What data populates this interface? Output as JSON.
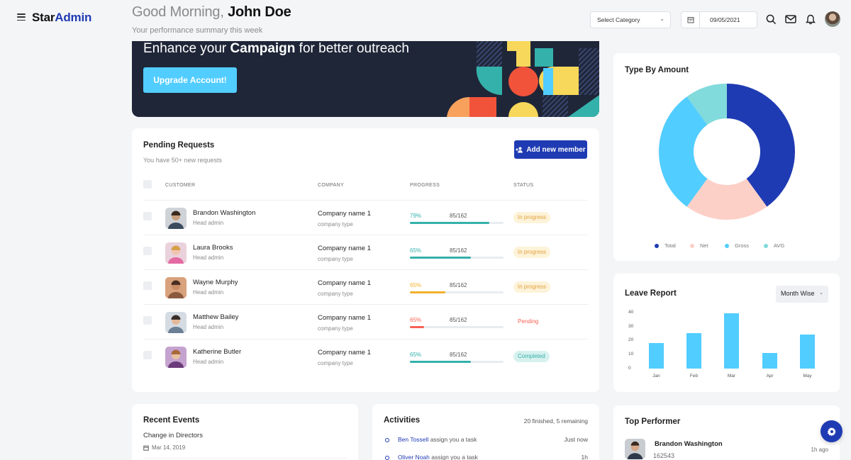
{
  "brand": {
    "part1": "Star",
    "part2": "Admin"
  },
  "header": {
    "greeting": "Good Morning, ",
    "user_name": "John Doe",
    "subtitle": "Your performance summary this week",
    "category_select": "Select Category",
    "date": "09/05/2021",
    "icons": [
      "menu-icon",
      "calendar-icon",
      "search-icon",
      "mail-icon",
      "bell-icon",
      "avatar"
    ]
  },
  "banner": {
    "text_pre": "Enhance your ",
    "text_bold": "Campaign",
    "text_post": " for better outreach",
    "button": "Upgrade Account!"
  },
  "pending": {
    "title": "Pending Requests",
    "subtitle": "You have 50+ new requests",
    "add_button": "Add new member",
    "columns": {
      "customer": "CUSTOMER",
      "company": "COMPANY",
      "progress": "PROGRESS",
      "status": "STATUS"
    },
    "rows": [
      {
        "name": "Brandon Washington",
        "role": "Head admin",
        "company": "Company name 1",
        "company_type": "company type",
        "percent": "79%",
        "count": "85/162",
        "progress": 0.85,
        "bar_color": "#34b1aa",
        "status": "In progress",
        "status_bg": "#fdf3d8",
        "status_fg": "#e2a03f"
      },
      {
        "name": "Laura Brooks",
        "role": "Head admin",
        "company": "Company name 1",
        "company_type": "company type",
        "percent": "65%",
        "count": "85/162",
        "progress": 0.65,
        "bar_color": "#34b1aa",
        "status": "In progress",
        "status_bg": "#fdf3d8",
        "status_fg": "#e2a03f"
      },
      {
        "name": "Wayne Murphy",
        "role": "Head admin",
        "company": "Company name 1",
        "company_type": "company type",
        "percent": "65%",
        "count": "85/162",
        "progress": 0.38,
        "bar_color": "#f4b12d",
        "status": "In progress",
        "status_bg": "#fdf3d8",
        "status_fg": "#e2a03f"
      },
      {
        "name": "Matthew Bailey",
        "role": "Head admin",
        "company": "Company name 1",
        "company_type": "company type",
        "percent": "65%",
        "count": "85/162",
        "progress": 0.15,
        "bar_color": "#f95f53",
        "status": "Pending",
        "status_bg": "#ffffff",
        "status_fg": "#f95f53"
      },
      {
        "name": "Katherine Butler",
        "role": "Head admin",
        "company": "Company name 1",
        "company_type": "company type",
        "percent": "65%",
        "count": "85/162",
        "progress": 0.65,
        "bar_color": "#34b1aa",
        "status": "Completed",
        "status_bg": "#d7f1ef",
        "status_fg": "#34b1aa"
      }
    ]
  },
  "recent_events": {
    "title": "Recent Events",
    "event": "Change in Directors",
    "date": "Mar 14, 2019"
  },
  "activities": {
    "title": "Activities",
    "summary": "20 finished, 5 remaining",
    "items": [
      {
        "who": "Ben Tossell",
        "text": " assign you a task",
        "time": "Just now"
      },
      {
        "who": "Oliver Noah",
        "text": " assign you a task",
        "time": "1h"
      }
    ]
  },
  "type_by_amount": {
    "title": "Type By Amount",
    "legend": [
      "Total",
      "Net",
      "Gross",
      "AVG"
    ],
    "colors": [
      "#1f3bb3",
      "#fdd0c7",
      "#52cdff",
      "#81dadb"
    ]
  },
  "leave_report": {
    "title": "Leave Report",
    "select": "Month Wise",
    "yticks": [
      "40",
      "30",
      "20",
      "10",
      "0"
    ]
  },
  "chart_data": [
    {
      "type": "pie",
      "title": "Type By Amount",
      "labels": [
        "Total",
        "Net",
        "Gross",
        "AVG"
      ],
      "values": [
        40,
        20,
        30,
        10
      ],
      "colors": [
        "#1f3bb3",
        "#fdd0c7",
        "#52cdff",
        "#81dadb"
      ]
    },
    {
      "type": "bar",
      "title": "Leave Report",
      "categories": [
        "Jan",
        "Feb",
        "Mar",
        "Apr",
        "May"
      ],
      "values": [
        18,
        25,
        39,
        11,
        24
      ],
      "ylim": [
        0,
        40
      ],
      "color": "#52cdff"
    }
  ],
  "top_performer": {
    "title": "Top Performer",
    "name": "Brandon Washington",
    "value": "162543",
    "time": "1h ago"
  }
}
